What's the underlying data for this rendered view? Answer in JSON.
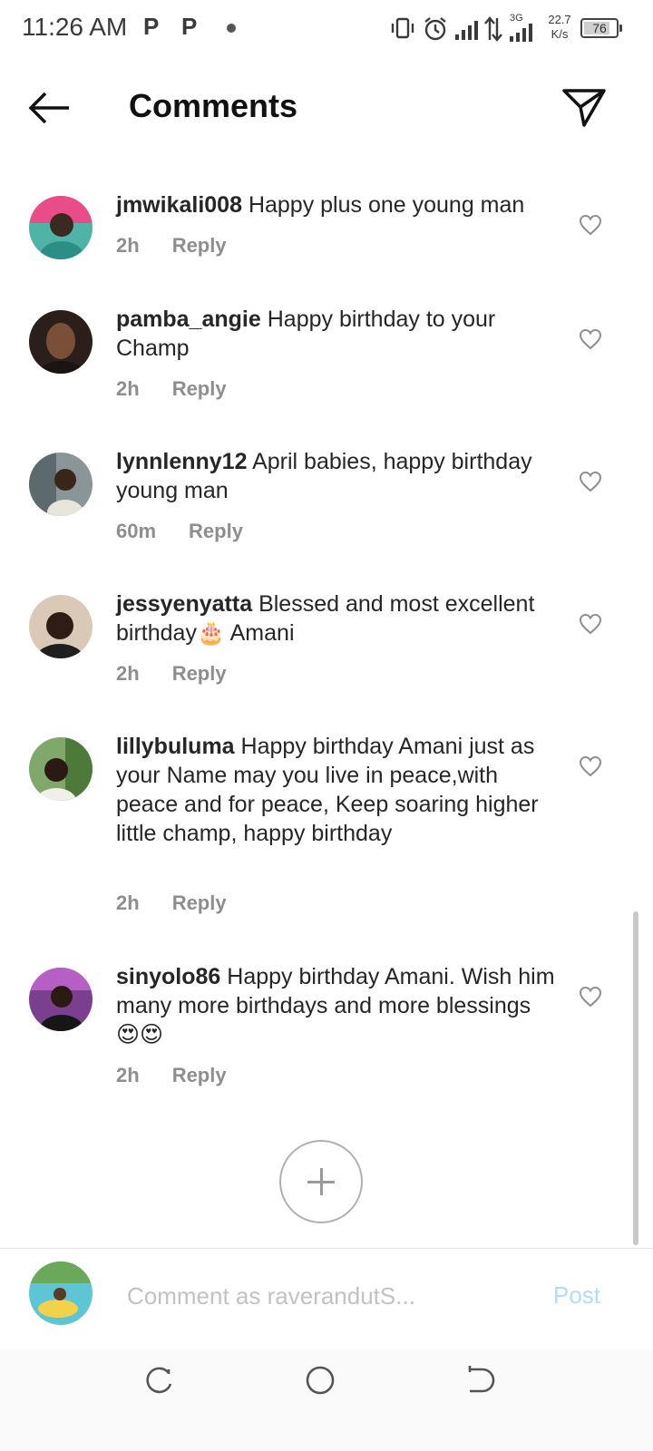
{
  "status_bar": {
    "time": "11:26 AM",
    "notif_icons": [
      "P",
      "P"
    ],
    "net_type": "3G",
    "net_speed_value": "22.7",
    "net_speed_unit": "K/s",
    "battery": "76"
  },
  "header": {
    "title": "Comments",
    "back_icon": "arrow-left-icon",
    "share_icon": "paper-plane-icon"
  },
  "comments": [
    {
      "username": "jmwikali008",
      "text": "Happy plus one young man",
      "time": "2h",
      "reply": "Reply"
    },
    {
      "username": "pamba_angie",
      "text": "Happy birthday to your Champ",
      "time": "2h",
      "reply": "Reply"
    },
    {
      "username": "lynnlenny12",
      "text": "April babies, happy birthday young man",
      "time": "60m",
      "reply": "Reply"
    },
    {
      "username": "jessyenyatta",
      "text": "Blessed and most excellent birthday🎂 Amani",
      "time": "2h",
      "reply": "Reply"
    },
    {
      "username": "lillybuluma",
      "text": "Happy birthday Amani just as your Name may you live in peace,with peace and for peace, Keep soaring higher little champ, happy birthday",
      "time": "2h",
      "reply": "Reply"
    },
    {
      "username": "sinyolo86",
      "text": "Happy birthday Amani. Wish him many more birthdays and more blessings 😍😍",
      "time": "2h",
      "reply": "Reply"
    }
  ],
  "composer": {
    "placeholder": "Comment as raverandutS...",
    "post_label": "Post"
  },
  "colors": {
    "post_disabled": "#b3dbff",
    "meta_gray": "#8e8e8e",
    "text": "#262626"
  }
}
